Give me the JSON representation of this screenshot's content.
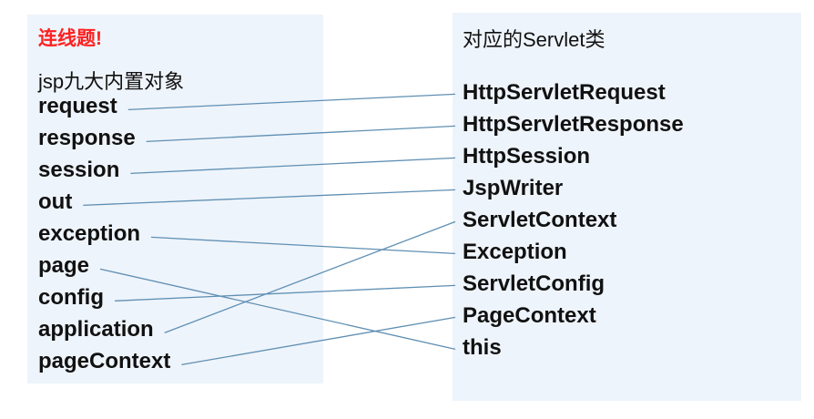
{
  "title": "连线题!",
  "left_header": "jsp九大内置对象",
  "right_header": "对应的Servlet类",
  "left_items": [
    "request",
    "response",
    "session",
    "out",
    "exception",
    "page",
    "config",
    "application",
    "pageContext"
  ],
  "right_items": [
    "HttpServletRequest",
    "HttpServletResponse",
    "HttpSession",
    "JspWriter",
    "ServletContext",
    "Exception",
    "ServletConfig",
    "PageContext",
    "this"
  ],
  "connections": [
    [
      0,
      0
    ],
    [
      1,
      1
    ],
    [
      2,
      2
    ],
    [
      3,
      3
    ],
    [
      4,
      5
    ],
    [
      5,
      8
    ],
    [
      6,
      6
    ],
    [
      7,
      4
    ],
    [
      8,
      7
    ]
  ],
  "colors": {
    "title": "#ff2020",
    "panel_background": "#eef4fb",
    "connector_line": "#5f8fb3"
  }
}
